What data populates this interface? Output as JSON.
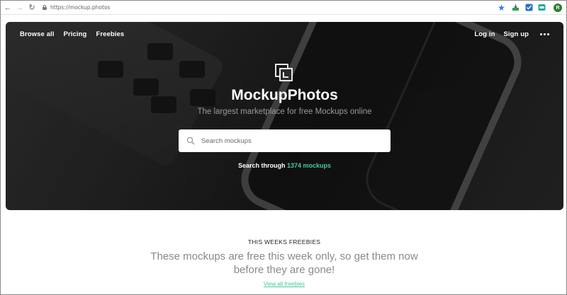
{
  "browser": {
    "url": "https://mockup.photos",
    "avatar_letter": "R"
  },
  "nav": {
    "left": [
      "Browse all",
      "Pricing",
      "Freebies"
    ],
    "login": "Log in",
    "signup": "Sign up"
  },
  "hero": {
    "brand": "MockupPhotos",
    "tagline": "The largest marketplace for free Mockups online",
    "search_placeholder": "Search mockups",
    "count_prefix": "Search through",
    "count_value": "1374 mockups"
  },
  "freebies": {
    "title": "THIS WEEKS FREEBIES",
    "subtitle": "These mockups are free this week only, so get them now before they are gone!",
    "link": "View all freebies"
  },
  "colors": {
    "accent": "#49c9a0",
    "star": "#3b78e7"
  },
  "icons": [
    "back-arrow-icon",
    "forward-arrow-icon",
    "reload-icon",
    "lock-icon",
    "star-icon",
    "search-icon",
    "logo-icon",
    "more-dots-icon"
  ]
}
